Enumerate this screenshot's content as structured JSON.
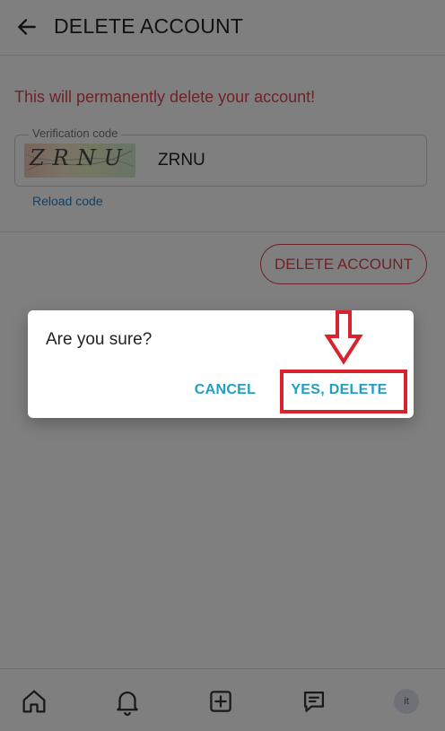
{
  "header": {
    "title": "DELETE ACCOUNT"
  },
  "warning": "This will permanently delete your account!",
  "verification": {
    "legend": "Verification code",
    "captcha_text": "ZRNU",
    "input_value": "ZRNU",
    "reload_label": "Reload code"
  },
  "delete_button_label": "DELETE ACCOUNT",
  "dialog": {
    "message": "Are you sure?",
    "cancel_label": "CANCEL",
    "confirm_label": "YES, DELETE"
  },
  "bottom_nav": {
    "items": [
      "home-icon",
      "bell-icon",
      "plus-square-icon",
      "chat-icon"
    ],
    "avatar_initials": "it"
  },
  "colors": {
    "danger": "#e0444e",
    "link": "#2a7fc5",
    "dialog_action": "#1f9fc4",
    "highlight": "#d8232f"
  }
}
